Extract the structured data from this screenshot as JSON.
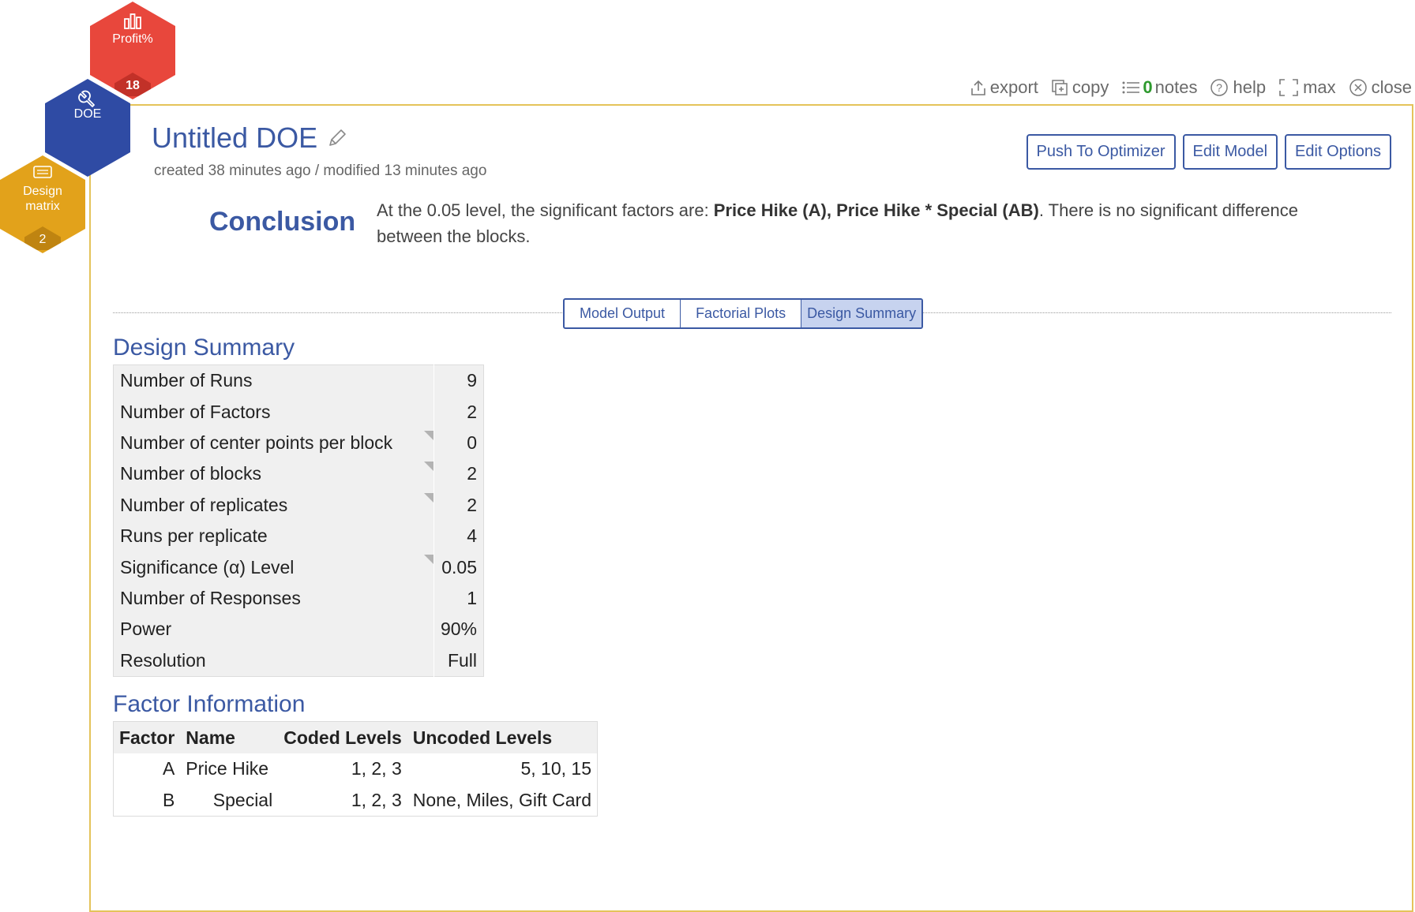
{
  "nav": {
    "profit": {
      "label": "Profit%",
      "count": "18",
      "color": "#e8473c"
    },
    "doe": {
      "label": "DOE",
      "color": "#2f4ba4"
    },
    "design": {
      "label_line1": "Design",
      "label_line2": "matrix",
      "count": "2",
      "color": "#e2a21b"
    }
  },
  "toolbar": {
    "export_label": "export",
    "copy_label": "copy",
    "notes_count": "0",
    "notes_label": "notes",
    "help_label": "help",
    "max_label": "max",
    "close_label": "close"
  },
  "header": {
    "title": "Untitled DOE",
    "subtitle": "created 38 minutes ago / modified 13 minutes ago",
    "buttons": {
      "push": "Push To Optimizer",
      "edit_model": "Edit Model",
      "edit_options": "Edit Options"
    }
  },
  "conclusion": {
    "label": "Conclusion",
    "prefix": "At the 0.05 level, the significant factors are: ",
    "factors": "Price Hike (A), Price Hike * Special (AB)",
    "suffix": ". There is no significant difference between the blocks."
  },
  "tabs": [
    {
      "label": "Model Output",
      "active": false
    },
    {
      "label": "Factorial Plots",
      "active": false
    },
    {
      "label": "Design Summary",
      "active": true
    }
  ],
  "design_summary": {
    "title": "Design Summary",
    "rows": [
      {
        "label": "Number of Runs",
        "value": "9"
      },
      {
        "label": "Number of Factors",
        "value": "2"
      },
      {
        "label": "Number of center points per block",
        "value": "0"
      },
      {
        "label": "Number of blocks",
        "value": "2"
      },
      {
        "label": "Number of replicates",
        "value": "2"
      },
      {
        "label": "Runs per replicate",
        "value": "4"
      },
      {
        "label": "Significance (α) Level",
        "value": "0.05"
      },
      {
        "label": "Number of Responses",
        "value": "1"
      },
      {
        "label": "Power",
        "value": "90%"
      },
      {
        "label": "Resolution",
        "value": "Full"
      }
    ]
  },
  "factor_info": {
    "title": "Factor Information",
    "headers": [
      "Factor",
      "Name",
      "Coded Levels",
      "Uncoded Levels"
    ],
    "rows": [
      {
        "factor": "A",
        "name": "Price Hike",
        "coded": "1, 2, 3",
        "uncoded": "5, 10, 15"
      },
      {
        "factor": "B",
        "name": "Special",
        "coded": "1, 2, 3",
        "uncoded": "None, Miles, Gift Card"
      }
    ]
  },
  "colors": {
    "accent": "#3b59a3",
    "panel_border": "#e4c35a",
    "notes_green": "#2e9a2e",
    "value_green": "#2e7d32"
  }
}
